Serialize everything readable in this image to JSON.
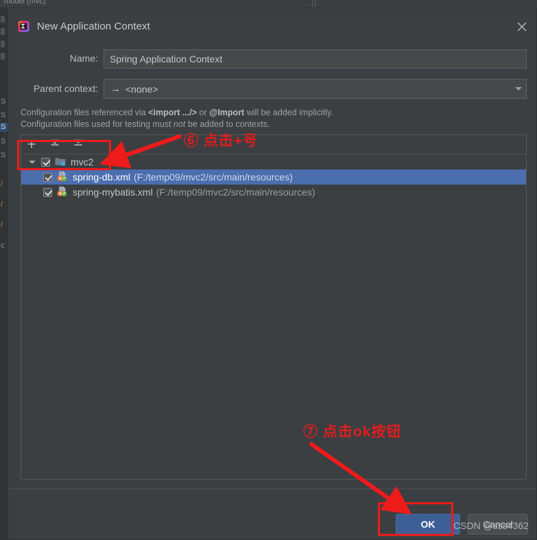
{
  "background": {
    "top_text": "model (mvc)",
    "code_hints": [
      "/",
      "/",
      "/",
      "c",
      "S",
      "S",
      "S",
      "S"
    ]
  },
  "dialog": {
    "title": "New Application Context",
    "app_icon": "intellij-idea-icon",
    "close_icon": "close-icon",
    "fields": {
      "name_label": "Name:",
      "name_value": "Spring Application Context",
      "parent_label": "Parent context:",
      "parent_value": "<none>",
      "parent_arrow_glyph": "→"
    },
    "description": {
      "line1_part1": "Configuration files referenced via ",
      "line1_bold1": "<import .../>",
      "line1_part2": " or ",
      "line1_bold2": "@Import",
      "line1_part3": " will be added implicitly.",
      "line2_part1": "Configuration files used for testing must ",
      "line2_italic": "not",
      "line2_part2": " be added to contexts."
    },
    "toolbar": [
      {
        "name": "add-button",
        "icon": "plus-icon",
        "tooltip": "Add"
      },
      {
        "name": "expand-all-button",
        "icon": "expand-all-icon",
        "tooltip": "Expand All"
      },
      {
        "name": "collapse-all-button",
        "icon": "collapse-all-icon",
        "tooltip": "Collapse All"
      }
    ],
    "tree": [
      {
        "name": "mvc2",
        "path": "",
        "icon": "module-folder-icon",
        "checked": true,
        "selected": false,
        "expanded": true,
        "depth": 0
      },
      {
        "name": "spring-db.xml",
        "path": "(F:/temp09/mvc2/src/main/resources)",
        "icon": "spring-xml-file-icon",
        "checked": true,
        "selected": true,
        "expanded": false,
        "depth": 1
      },
      {
        "name": "spring-mybatis.xml",
        "path": "(F:/temp09/mvc2/src/main/resources)",
        "icon": "spring-xml-file-icon",
        "checked": true,
        "selected": false,
        "expanded": false,
        "depth": 1
      }
    ],
    "buttons": {
      "ok": "OK",
      "cancel": "Cancel"
    }
  },
  "annotations": {
    "step6": "⑥ 点击+号",
    "step7": "⑦ 点击ok按钮",
    "color": "#ee1b1b"
  },
  "watermark": "CSDN @sss4362"
}
